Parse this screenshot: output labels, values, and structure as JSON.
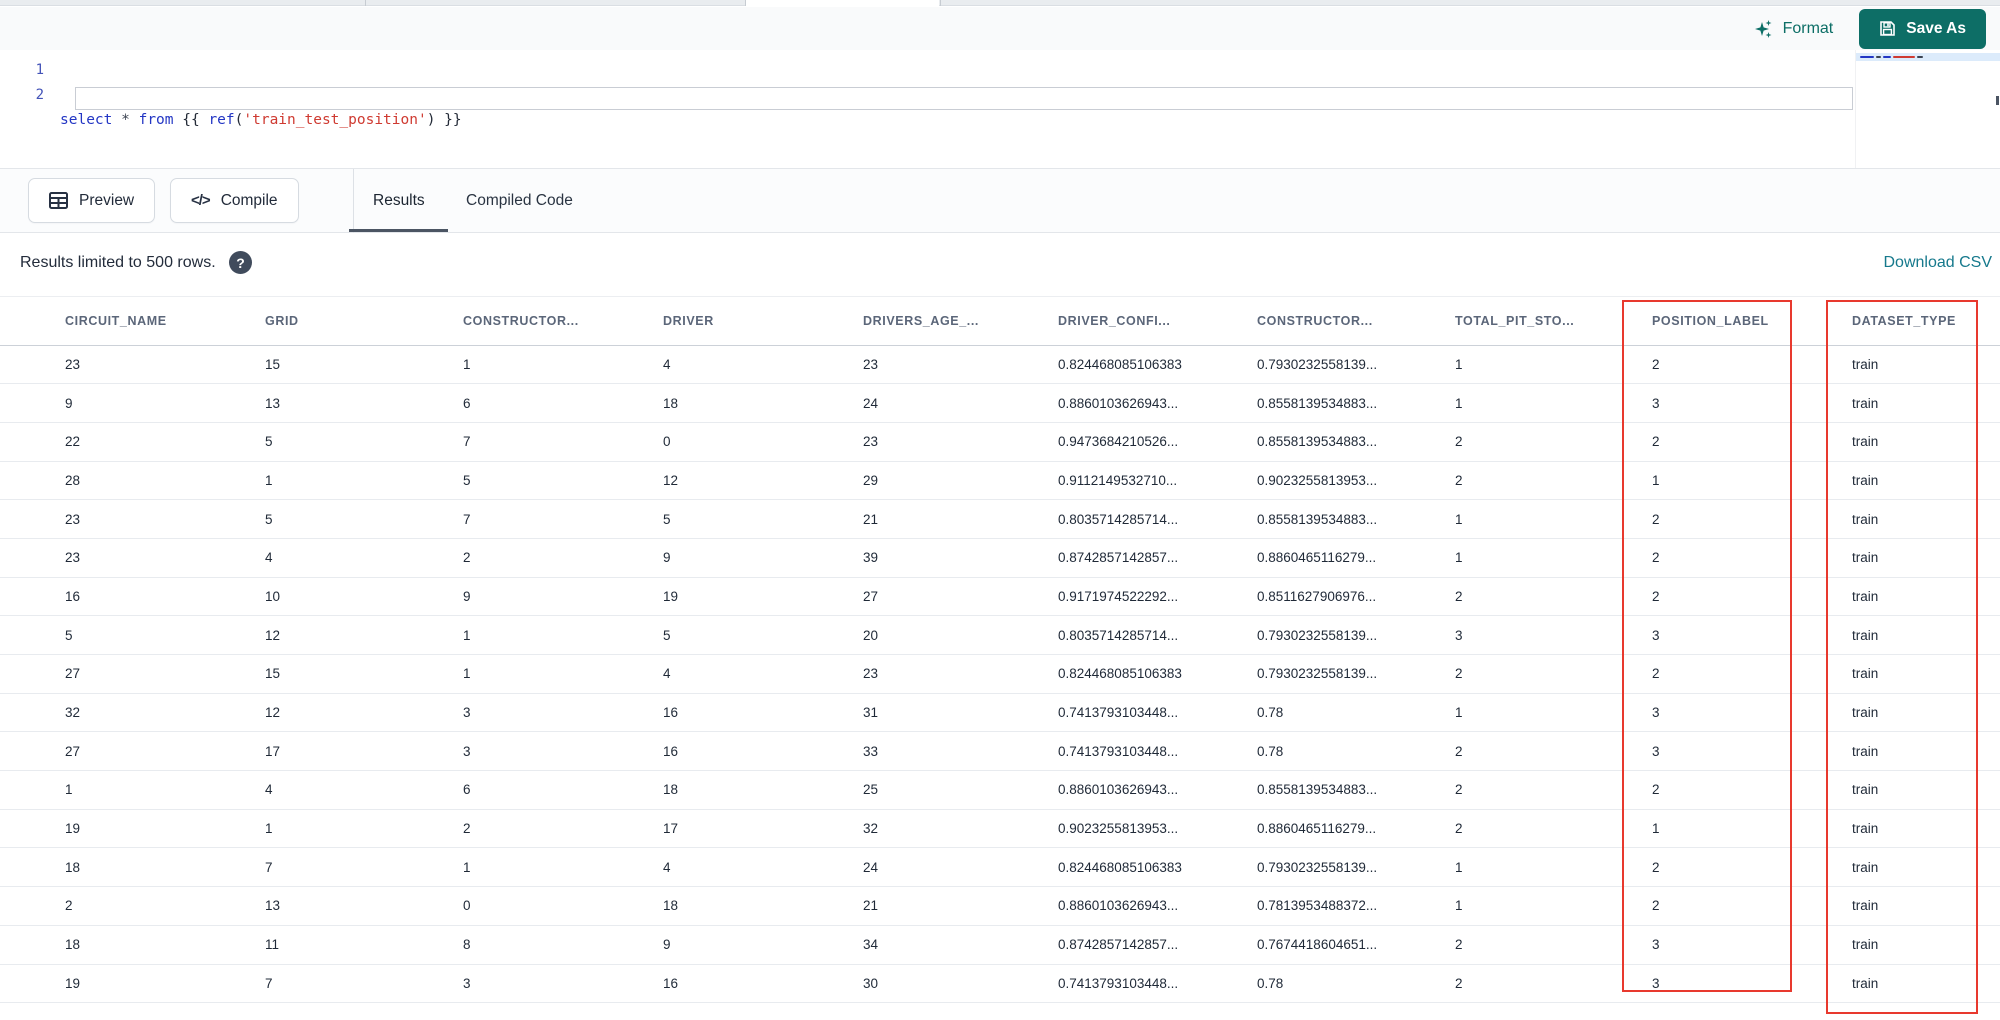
{
  "editor": {
    "line_numbers": [
      "1",
      "2"
    ],
    "code_tokens": [
      {
        "text": "select",
        "type": "keyword"
      },
      {
        "text": " ",
        "type": "plain"
      },
      {
        "text": "*",
        "type": "operator"
      },
      {
        "text": " ",
        "type": "plain"
      },
      {
        "text": "from",
        "type": "keyword"
      },
      {
        "text": " {{ ",
        "type": "plain"
      },
      {
        "text": "ref",
        "type": "function"
      },
      {
        "text": "(",
        "type": "plain"
      },
      {
        "text": "'train_test_position'",
        "type": "string"
      },
      {
        "text": ")",
        "type": "plain"
      },
      {
        "text": " }}",
        "type": "plain"
      }
    ]
  },
  "header_actions": {
    "format_label": "Format",
    "save_as_label": "Save As"
  },
  "toolbar": {
    "preview_label": "Preview",
    "compile_label": "Compile",
    "compile_glyph": "</>"
  },
  "tabs": [
    {
      "label": "Results",
      "active": true
    },
    {
      "label": "Compiled Code",
      "active": false
    }
  ],
  "results_info": {
    "limit_text": "Results limited to 500 rows.",
    "help_glyph": "?",
    "download_label": "Download CSV"
  },
  "table": {
    "columns": [
      "CIRCUIT_NAME",
      "GRID",
      "CONSTRUCTOR...",
      "DRIVER",
      "DRIVERS_AGE_...",
      "DRIVER_CONFI...",
      "CONSTRUCTOR...",
      "TOTAL_PIT_STO...",
      "POSITION_LABEL",
      "DATASET_TYPE"
    ],
    "highlighted_columns": [
      "POSITION_LABEL",
      "DATASET_TYPE"
    ],
    "highlight_color": "#e8392e",
    "rows": [
      [
        "23",
        "15",
        "1",
        "4",
        "23",
        "0.824468085106383",
        "0.7930232558139...",
        "1",
        "2",
        "train"
      ],
      [
        "9",
        "13",
        "6",
        "18",
        "24",
        "0.8860103626943...",
        "0.8558139534883...",
        "1",
        "3",
        "train"
      ],
      [
        "22",
        "5",
        "7",
        "0",
        "23",
        "0.9473684210526...",
        "0.8558139534883...",
        "2",
        "2",
        "train"
      ],
      [
        "28",
        "1",
        "5",
        "12",
        "29",
        "0.9112149532710...",
        "0.9023255813953...",
        "2",
        "1",
        "train"
      ],
      [
        "23",
        "5",
        "7",
        "5",
        "21",
        "0.8035714285714...",
        "0.8558139534883...",
        "1",
        "2",
        "train"
      ],
      [
        "23",
        "4",
        "2",
        "9",
        "39",
        "0.8742857142857...",
        "0.8860465116279...",
        "1",
        "2",
        "train"
      ],
      [
        "16",
        "10",
        "9",
        "19",
        "27",
        "0.9171974522292...",
        "0.8511627906976...",
        "2",
        "2",
        "train"
      ],
      [
        "5",
        "12",
        "1",
        "5",
        "20",
        "0.8035714285714...",
        "0.7930232558139...",
        "3",
        "3",
        "train"
      ],
      [
        "27",
        "15",
        "1",
        "4",
        "23",
        "0.824468085106383",
        "0.7930232558139...",
        "2",
        "2",
        "train"
      ],
      [
        "32",
        "12",
        "3",
        "16",
        "31",
        "0.7413793103448...",
        "0.78",
        "1",
        "3",
        "train"
      ],
      [
        "27",
        "17",
        "3",
        "16",
        "33",
        "0.7413793103448...",
        "0.78",
        "2",
        "3",
        "train"
      ],
      [
        "1",
        "4",
        "6",
        "18",
        "25",
        "0.8860103626943...",
        "0.8558139534883...",
        "2",
        "2",
        "train"
      ],
      [
        "19",
        "1",
        "2",
        "17",
        "32",
        "0.9023255813953...",
        "0.8860465116279...",
        "2",
        "1",
        "train"
      ],
      [
        "18",
        "7",
        "1",
        "4",
        "24",
        "0.824468085106383",
        "0.7930232558139...",
        "1",
        "2",
        "train"
      ],
      [
        "2",
        "13",
        "0",
        "18",
        "21",
        "0.8860103626943...",
        "0.7813953488372...",
        "1",
        "2",
        "train"
      ],
      [
        "18",
        "11",
        "8",
        "9",
        "34",
        "0.8742857142857...",
        "0.7674418604651...",
        "2",
        "3",
        "train"
      ],
      [
        "19",
        "7",
        "3",
        "16",
        "30",
        "0.7413793103448...",
        "0.78",
        "2",
        "3",
        "train"
      ]
    ]
  },
  "colors": {
    "accent_teal": "#0d6e66",
    "link_teal": "#16798c",
    "keyword_blue": "#2336c4",
    "string_red": "#cf3a31",
    "highlight_red": "#e8392e"
  }
}
